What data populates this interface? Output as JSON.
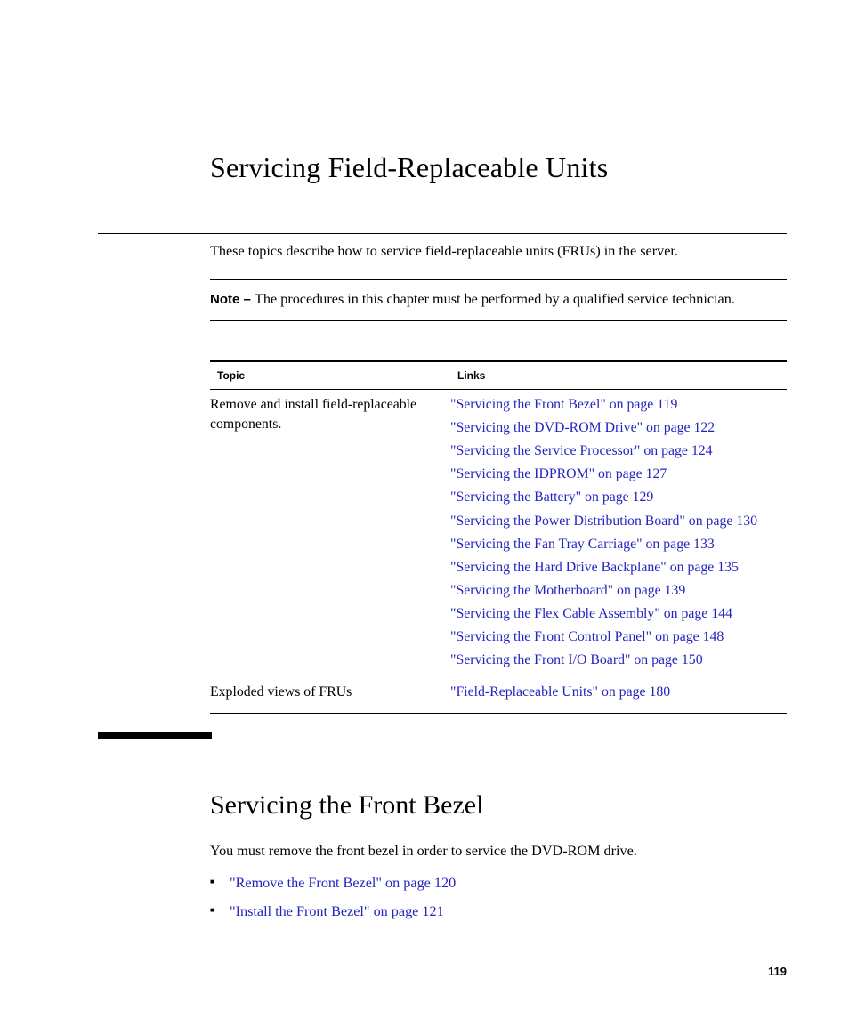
{
  "chapterTitle": "Servicing Field-Replaceable Units",
  "intro": "These topics describe how to service field-replaceable units (FRUs) in the server.",
  "note": {
    "label": "Note – ",
    "text": "The procedures in this chapter must be performed by a qualified service technician."
  },
  "table": {
    "headers": {
      "col1": "Topic",
      "col2": "Links"
    },
    "rows": [
      {
        "topic": "Remove and install field-replaceable components.",
        "links": [
          "\"Servicing the Front Bezel\" on page 119",
          "\"Servicing the DVD-ROM Drive\" on page 122",
          "\"Servicing the Service Processor\" on page 124",
          "\"Servicing the IDPROM\" on page 127",
          "\"Servicing the Battery\" on page 129",
          "\"Servicing the Power Distribution Board\" on page 130",
          "\"Servicing the Fan Tray Carriage\" on page 133",
          "\"Servicing the Hard Drive Backplane\" on page 135",
          "\"Servicing the Motherboard\" on page 139",
          "\"Servicing the Flex Cable Assembly\" on page 144",
          "\"Servicing the Front Control Panel\" on page 148",
          "\"Servicing the Front I/O Board\" on page 150"
        ]
      },
      {
        "topic": "Exploded views of FRUs",
        "links": [
          "\"Field-Replaceable Units\" on page 180"
        ]
      }
    ]
  },
  "section": {
    "title": "Servicing the Front Bezel",
    "intro": "You must remove the front bezel in order to service the DVD-ROM drive.",
    "bullets": [
      "\"Remove the Front Bezel\" on page 120",
      "\"Install the Front Bezel\" on page 121"
    ]
  },
  "pageNumber": "119"
}
